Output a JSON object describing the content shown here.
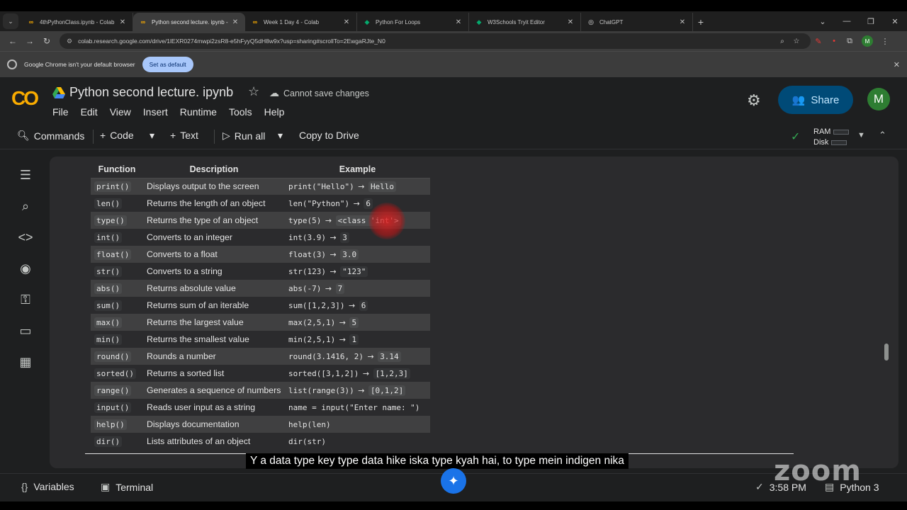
{
  "browser": {
    "tabs": [
      {
        "title": "4thPythonClass.ipynb - Colab",
        "favicon": "colab-icon",
        "active": false
      },
      {
        "title": "Python second lecture. ipynb -",
        "favicon": "colab-icon",
        "active": true
      },
      {
        "title": "Week 1 Day 4 - Colab",
        "favicon": "colab-icon",
        "active": false
      },
      {
        "title": "Python For Loops",
        "favicon": "w3schools-icon",
        "active": false
      },
      {
        "title": "W3Schools Tryit Editor",
        "favicon": "w3schools-icon",
        "active": false
      },
      {
        "title": "ChatGPT",
        "favicon": "chatgpt-icon",
        "active": false
      }
    ],
    "url": "colab.research.google.com/drive/1lEXR0274mwpi2zsR8-e5hFyyQ5dH8w9x?usp=sharing#scrollTo=2EwgaRJte_N0",
    "infobar": {
      "message": "Google Chrome isn't your default browser",
      "button": "Set as default"
    },
    "profile_initial": "M"
  },
  "colab": {
    "notebook_title": "Python second lecture. ipynb",
    "save_status": "Cannot save changes",
    "menu": [
      "File",
      "Edit",
      "View",
      "Insert",
      "Runtime",
      "Tools",
      "Help"
    ],
    "share_label": "Share",
    "avatar_initial": "M",
    "toolbar": {
      "commands": "Commands",
      "code": "Code",
      "text": "Text",
      "run_all": "Run all",
      "copy_to_drive": "Copy to Drive",
      "ram": "RAM",
      "disk": "Disk"
    },
    "status": {
      "variables": "Variables",
      "terminal": "Terminal",
      "time": "3:58 PM",
      "runtime": "Python 3"
    }
  },
  "table": {
    "headers": [
      "Function",
      "Description",
      "Example"
    ],
    "rows": [
      {
        "fn": "print()",
        "desc": "Displays output to the screen",
        "ex_code": "print(\"Hello\")",
        "ex_result": "Hello"
      },
      {
        "fn": "len()",
        "desc": "Returns the length of an object",
        "ex_code": "len(\"Python\")",
        "ex_result": "6"
      },
      {
        "fn": "type()",
        "desc": "Returns the type of an object",
        "ex_code": "type(5)",
        "ex_result": "<class 'int'>"
      },
      {
        "fn": "int()",
        "desc": "Converts to an integer",
        "ex_code": "int(3.9)",
        "ex_result": "3"
      },
      {
        "fn": "float()",
        "desc": "Converts to a float",
        "ex_code": "float(3)",
        "ex_result": "3.0"
      },
      {
        "fn": "str()",
        "desc": "Converts to a string",
        "ex_code": "str(123)",
        "ex_result": "\"123\""
      },
      {
        "fn": "abs()",
        "desc": "Returns absolute value",
        "ex_code": "abs(-7)",
        "ex_result": "7"
      },
      {
        "fn": "sum()",
        "desc": "Returns sum of an iterable",
        "ex_code": "sum([1,2,3])",
        "ex_result": "6"
      },
      {
        "fn": "max()",
        "desc": "Returns the largest value",
        "ex_code": "max(2,5,1)",
        "ex_result": "5"
      },
      {
        "fn": "min()",
        "desc": "Returns the smallest value",
        "ex_code": "min(2,5,1)",
        "ex_result": "1"
      },
      {
        "fn": "round()",
        "desc": "Rounds a number",
        "ex_code": "round(3.1416, 2)",
        "ex_result": "3.14"
      },
      {
        "fn": "sorted()",
        "desc": "Returns a sorted list",
        "ex_code": "sorted([3,1,2])",
        "ex_result": "[1,2,3]"
      },
      {
        "fn": "range()",
        "desc": "Generates a sequence of numbers",
        "ex_code": "list(range(3))",
        "ex_result": "[0,1,2]"
      },
      {
        "fn": "input()",
        "desc": "Reads user input as a string",
        "ex_code": "name = input(\"Enter name: \")",
        "ex_result": ""
      },
      {
        "fn": "help()",
        "desc": "Displays documentation",
        "ex_code": "help(len)",
        "ex_result": ""
      },
      {
        "fn": "dir()",
        "desc": "Lists attributes of an object",
        "ex_code": "dir(str)",
        "ex_result": ""
      }
    ]
  },
  "subtitle": "Y a data type key type data hike iska type kyah hai, to type mein indigen nika",
  "watermark": "zoom",
  "colors": {
    "colab_orange": "#f9ab00",
    "share_bg": "#004a77",
    "share_fg": "#c2e7ff",
    "avatar_green": "#2e7d32",
    "run_check": "#34a853"
  }
}
